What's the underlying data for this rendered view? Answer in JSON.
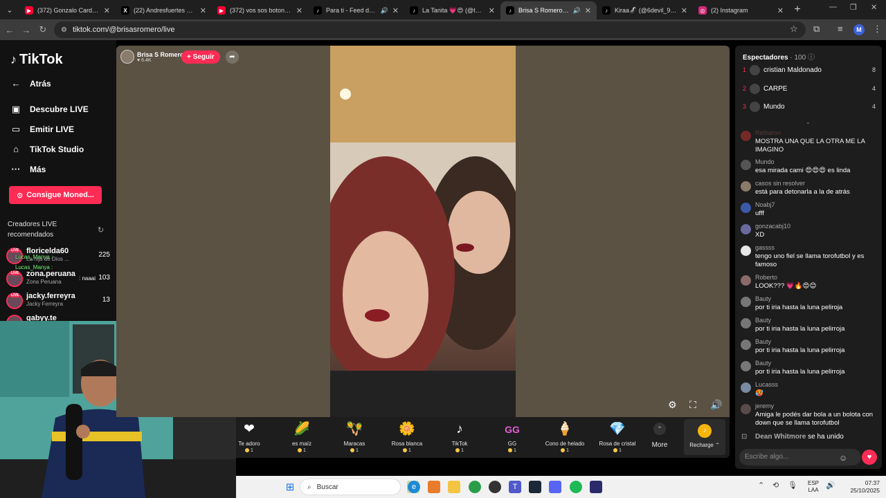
{
  "browser": {
    "tabs": [
      {
        "title": "(372) Gonzalo Cardozo -",
        "favicon": "youtube-icon",
        "active": false,
        "audio": false
      },
      {
        "title": "(22) Andresfuertes en X:",
        "favicon": "x-icon",
        "active": false,
        "audio": false
      },
      {
        "title": "(372) vos sos boton flor d",
        "favicon": "youtube-icon",
        "active": false,
        "audio": false
      },
      {
        "title": "Para ti - Feed de TikTo",
        "favicon": "tiktok-icon",
        "active": false,
        "audio": true
      },
      {
        "title": "La Tanita 💗😍 (@tana2",
        "favicon": "tiktok-icon",
        "active": false,
        "audio": false
      },
      {
        "title": "Brisa S Romero (@bri",
        "favicon": "tiktok-icon",
        "active": true,
        "audio": true
      },
      {
        "title": "Kiraa🦨 (@6devil_9_) | Ti",
        "favicon": "tiktok-icon",
        "active": false,
        "audio": false
      },
      {
        "title": "(2) Instagram",
        "favicon": "instagram-icon",
        "active": false,
        "audio": false
      }
    ],
    "url": "tiktok.com/@brisasromero/live",
    "profile_initial": "M"
  },
  "sidebar": {
    "logo": "TikTok",
    "back": "Atrás",
    "items": [
      {
        "label": "Descubre LIVE",
        "icon": "live-tv-icon"
      },
      {
        "label": "Emitir LIVE",
        "icon": "camera-icon"
      },
      {
        "label": "TikTok Studio",
        "icon": "studio-icon"
      },
      {
        "label": "Más",
        "icon": "more-dots-icon"
      }
    ],
    "coins_button": "Consigue Moned...",
    "recommended_title": "Creadores LIVE recomendados",
    "creators": [
      {
        "name": "floricelda60",
        "sub": "La hija de Dios ...",
        "count": "225"
      },
      {
        "name": "zona.peruana",
        "sub": "Zona Peruana",
        "count": "103"
      },
      {
        "name": "jacky.ferreyra",
        "sub": "Jacky Ferreyra",
        "count": "13"
      },
      {
        "name": "gabyy.te",
        "sub": "",
        "count": ""
      }
    ],
    "overlay_chat": [
      {
        "user": "Lucas_Manya :",
        "text": ""
      },
      {
        "user": "Lucas_Manya :",
        "text": ""
      },
      {
        "user": "",
        "text": ": naaai"
      }
    ]
  },
  "stage": {
    "host_name": "Brisa S Romero",
    "host_likes": "6.4K",
    "follow_label": "+ Seguir"
  },
  "gifts": [
    {
      "label": "Te adoro",
      "price": "1",
      "icon": "heart-gift-icon",
      "glyph": "❤"
    },
    {
      "label": "es maíz",
      "price": "1",
      "icon": "corn-icon",
      "glyph": "🌽"
    },
    {
      "label": "Maracas",
      "price": "1",
      "icon": "maracas-icon",
      "glyph": "🪇"
    },
    {
      "label": "Rosa blanca",
      "price": "1",
      "icon": "white-rose-icon",
      "glyph": "🌼"
    },
    {
      "label": "TikTok",
      "price": "1",
      "icon": "tiktok-gift-icon",
      "glyph": "♪"
    },
    {
      "label": "GG",
      "price": "1",
      "icon": "gg-icon",
      "glyph": "GG"
    },
    {
      "label": "Cono de helado",
      "price": "1",
      "icon": "ice-cream-icon",
      "glyph": "🍦"
    },
    {
      "label": "Rosa de cristal",
      "price": "1",
      "icon": "crystal-rose-icon",
      "glyph": "💎"
    }
  ],
  "gift_bar": {
    "more_label": "More",
    "recharge_label": "Recharge"
  },
  "chat": {
    "viewers_label": "Espectadores",
    "viewers_count": "· 100",
    "ranking": [
      {
        "rank": "1",
        "name": "cristian Maldonado",
        "score": "8"
      },
      {
        "rank": "2",
        "name": "CARPE",
        "score": "4"
      },
      {
        "rank": "3",
        "name": "Mundo",
        "score": "4"
      }
    ],
    "messages": [
      {
        "user": "Retharon",
        "text": "MOSTRA UNA QUE LA OTRA ME LA IMAGINO"
      },
      {
        "user": "Mundo",
        "text": "esa mirada cami 😍😍😍 es linda"
      },
      {
        "user": "casos sin resolver",
        "text": "está para detonarla a la de atrás"
      },
      {
        "user": "Noabj7",
        "text": "ufff"
      },
      {
        "user": "gonzacabj10",
        "text": "XD"
      },
      {
        "user": "gassss",
        "text": "tengo uno fiel se llama torofutbol y es famoso"
      },
      {
        "user": "Roberto",
        "text": "LOOK??? 💗🔥😍😊"
      },
      {
        "user": "Bauty",
        "text": "por ti iria hasta la luna peliroja"
      },
      {
        "user": "Bauty",
        "text": "por ti iria hasta la luna pelirroja"
      },
      {
        "user": "Bauty",
        "text": "por ti iria hasta la luna pelirroja"
      },
      {
        "user": "Bauty",
        "text": "por ti iria hasta la luna pelirroja"
      },
      {
        "user": "Lucasss",
        "text": "🥵"
      },
      {
        "user": "jeremy",
        "text": "Amiga le podés dar bola a un bolota con down que se llama torofutbol"
      }
    ],
    "join_notice_user": "Dean Whitmore",
    "join_notice_text": "se ha unido",
    "input_placeholder": "Escribe algo..."
  },
  "taskbar": {
    "search_placeholder": "Buscar",
    "lang_top": "ESP",
    "lang_bottom": "LAA",
    "time": "07:37",
    "date": "25/10/2025"
  },
  "colors": {
    "accent": "#fe2c55",
    "coin": "#f7c948"
  }
}
